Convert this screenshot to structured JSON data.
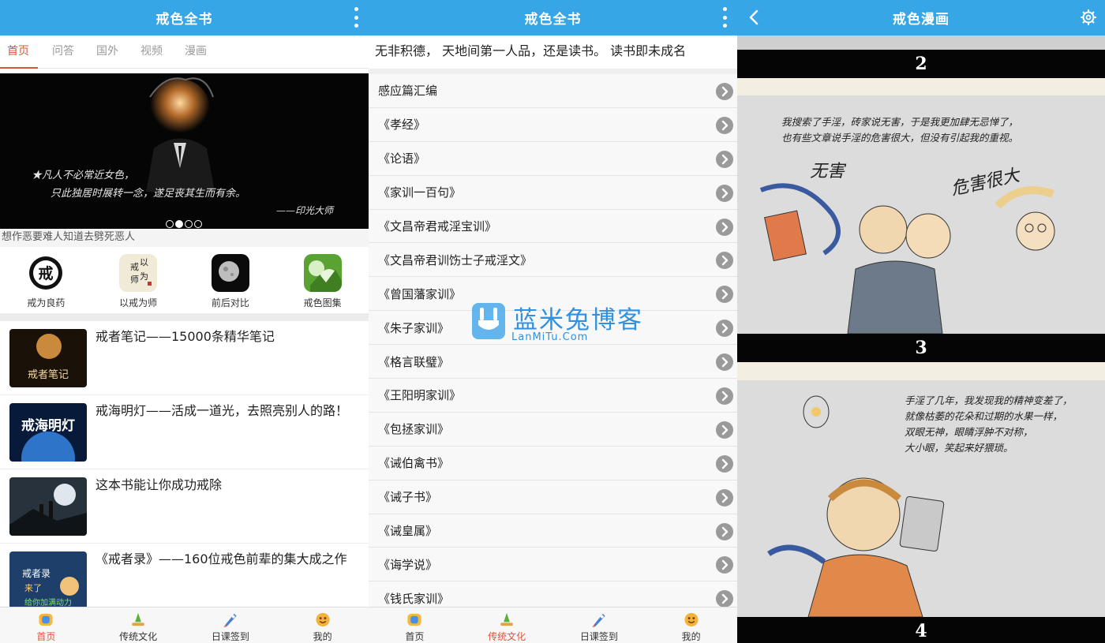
{
  "home": {
    "title": "戒色全书",
    "tabs": [
      "首页",
      "问答",
      "国外",
      "视频",
      "漫画"
    ],
    "banner": {
      "line1": "★凡人不必常近女色，",
      "line2": "只此独居时展转一念，遂足丧其生而有余。",
      "author": "——印光大师"
    },
    "ticker": "想作恶要难人知道去劈死恶人",
    "shortcuts": [
      {
        "label": "戒为良药"
      },
      {
        "label": "以戒为师"
      },
      {
        "label": "前后对比"
      },
      {
        "label": "戒色图集"
      }
    ],
    "articles": [
      {
        "title": "戒者笔记——15000条精华笔记"
      },
      {
        "title": "戒海明灯——活成一道光，去照亮别人的路！"
      },
      {
        "title": "这本书能让你成功戒除"
      },
      {
        "title": "《戒者录》——160位戒色前辈的集大成之作"
      }
    ],
    "thumbs": {
      "t1": "戒者笔记",
      "t2": "戒海明灯",
      "t4a": "戒者录",
      "t4b": "来了",
      "t4c": "给你加满动力"
    },
    "nav": [
      "首页",
      "传统文化",
      "日课签到",
      "我的"
    ]
  },
  "culture": {
    "title": "戒色全书",
    "marquee": "家，无非积德， 天地间第一人品，还是读书。 读书即未成名",
    "items": [
      "感应篇汇编",
      "《孝经》",
      "《论语》",
      "《家训一百句》",
      "《文昌帝君戒淫宝训》",
      "《文昌帝君训饬士子戒淫文》",
      "《曾国藩家训》",
      "《朱子家训》",
      "《格言联璧》",
      "《王阳明家训》",
      "《包拯家训》",
      "《诫伯禽书》",
      "《诫子书》",
      "《诫皇属》",
      "《诲学说》",
      "《钱氏家训》"
    ],
    "watermark": {
      "title": "蓝米兔博客",
      "sub": "LanMiTu.Com"
    },
    "nav": [
      "首页",
      "传统文化",
      "日课签到",
      "我的"
    ]
  },
  "comic": {
    "title": "戒色漫画",
    "panel_numbers": [
      "2",
      "3",
      "4"
    ],
    "panel1": {
      "line1": "我搜索了手淫，砖家说无害，于是我更加肆无忌惮了，",
      "line2": "也有些文章说手淫的危害很大，但没有引起我的重视。",
      "label_a": "无害",
      "label_b": "危害很大"
    },
    "panel2": {
      "line1": "手淫了几年，我发现我的精神变差了，",
      "line2": "就像枯萎的花朵和过期的水果一样，",
      "line3": "双眼无神，眼睛浮肿不对称，",
      "line4": "大小眼，笑起来好猥琐。"
    }
  },
  "colors": {
    "accent": "#36a6e6",
    "active": "#e0533a"
  }
}
